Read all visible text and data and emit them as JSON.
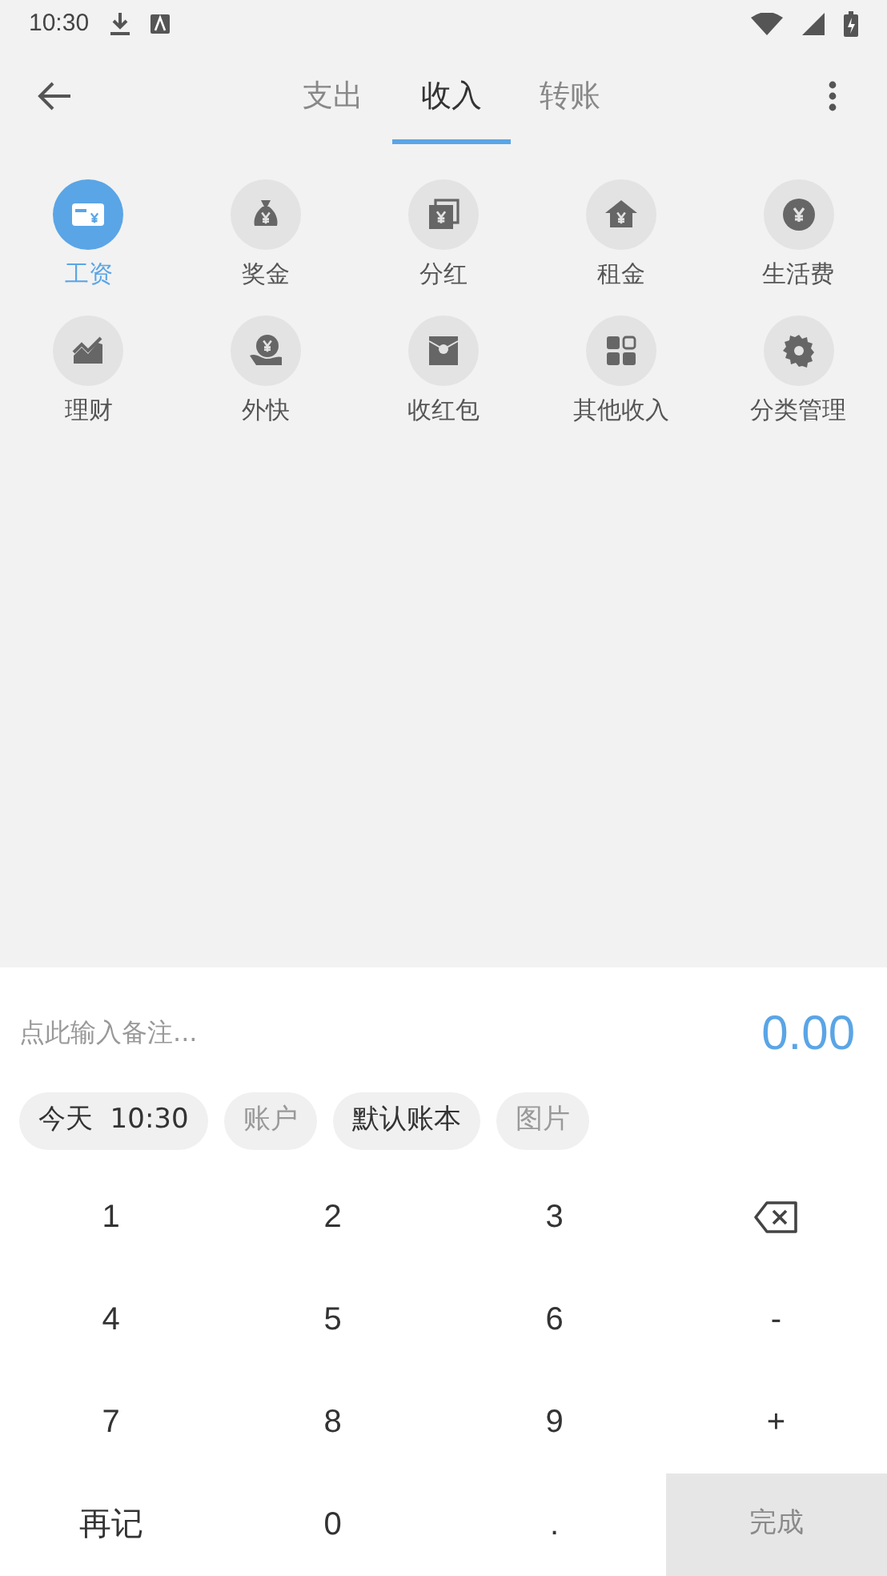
{
  "status_bar": {
    "time": "10:30"
  },
  "tabs": [
    {
      "label": "支出",
      "selected": false
    },
    {
      "label": "收入",
      "selected": true
    },
    {
      "label": "转账",
      "selected": false
    }
  ],
  "categories": [
    {
      "label": "工资",
      "selected": true
    },
    {
      "label": "奖金",
      "selected": false
    },
    {
      "label": "分红",
      "selected": false
    },
    {
      "label": "租金",
      "selected": false
    },
    {
      "label": "生活费",
      "selected": false
    },
    {
      "label": "理财",
      "selected": false
    },
    {
      "label": "外快",
      "selected": false
    },
    {
      "label": "收红包",
      "selected": false
    },
    {
      "label": "其他收入",
      "selected": false
    },
    {
      "label": "分类管理",
      "selected": false
    }
  ],
  "note": {
    "placeholder": "点此输入备注..."
  },
  "amount": "0.00",
  "chips": [
    {
      "label": "今天  10:30",
      "filled": true
    },
    {
      "label": "账户",
      "filled": false
    },
    {
      "label": "默认账本",
      "filled": true
    },
    {
      "label": "图片",
      "filled": false
    }
  ],
  "keys": [
    {
      "kind": "text",
      "label": "1"
    },
    {
      "kind": "text",
      "label": "2"
    },
    {
      "kind": "text",
      "label": "3"
    },
    {
      "kind": "backspace"
    },
    {
      "kind": "text",
      "label": "4"
    },
    {
      "kind": "text",
      "label": "5"
    },
    {
      "kind": "text",
      "label": "6"
    },
    {
      "kind": "text",
      "label": "-"
    },
    {
      "kind": "text",
      "label": "7"
    },
    {
      "kind": "text",
      "label": "8"
    },
    {
      "kind": "text",
      "label": "9"
    },
    {
      "kind": "text",
      "label": "+"
    },
    {
      "kind": "text",
      "label": "再记"
    },
    {
      "kind": "text",
      "label": "0"
    },
    {
      "kind": "text",
      "label": "."
    },
    {
      "kind": "done",
      "label": "完成",
      "disabled": true
    }
  ]
}
